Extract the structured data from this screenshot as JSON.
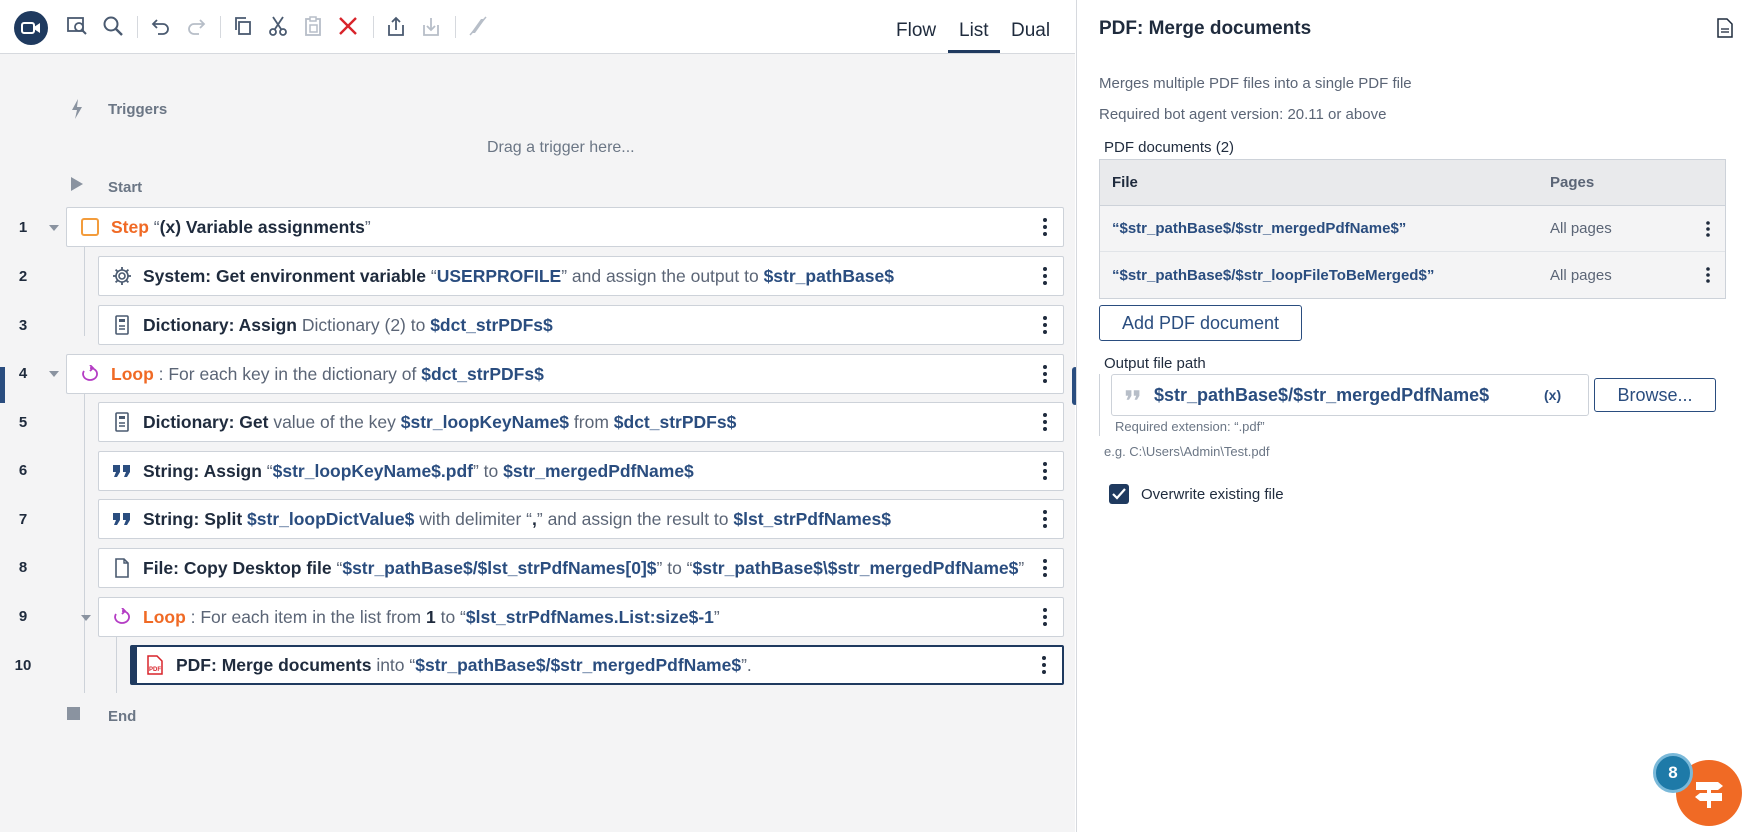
{
  "toolbar": {
    "views": [
      "Flow",
      "List",
      "Dual"
    ],
    "active_view": "List",
    "icons": [
      "record-icon",
      "search-file-icon",
      "search-icon",
      "undo-icon",
      "redo-icon",
      "copy-icon",
      "cut-icon",
      "paste-icon",
      "delete-icon",
      "export-icon",
      "import-icon",
      "disable-icon"
    ]
  },
  "editor": {
    "triggers_label": "Triggers",
    "drag_hint": "Drag a trigger here...",
    "start_label": "Start",
    "end_label": "End",
    "lines": [
      {
        "no": "1",
        "kind": "step",
        "parts": [
          [
            "orange",
            "Step"
          ],
          [
            "text",
            " “"
          ],
          [
            "bold",
            "(x) Variable assignments"
          ],
          [
            "text",
            "”"
          ]
        ]
      },
      {
        "no": "2",
        "kind": "system",
        "parts": [
          [
            "bold",
            "System: Get environment variable"
          ],
          [
            "text",
            " “"
          ],
          [
            "var",
            "USERPROFILE"
          ],
          [
            "text",
            "” and assign the output to "
          ],
          [
            "var",
            "$str_pathBase$"
          ]
        ]
      },
      {
        "no": "3",
        "kind": "dict",
        "parts": [
          [
            "bold",
            "Dictionary: Assign"
          ],
          [
            "text",
            " Dictionary (2) to "
          ],
          [
            "var",
            "$dct_strPDFs$"
          ]
        ]
      },
      {
        "no": "4",
        "kind": "loop",
        "parts": [
          [
            "orange",
            "Loop"
          ],
          [
            "text",
            " : For each key in the dictionary of "
          ],
          [
            "var",
            "$dct_strPDFs$"
          ]
        ]
      },
      {
        "no": "5",
        "kind": "dict",
        "parts": [
          [
            "bold",
            "Dictionary: Get"
          ],
          [
            "text",
            " value of the key "
          ],
          [
            "var",
            "$str_loopKeyName$"
          ],
          [
            "text",
            " from "
          ],
          [
            "var",
            "$dct_strPDFs$"
          ]
        ]
      },
      {
        "no": "6",
        "kind": "string",
        "parts": [
          [
            "bold",
            "String: Assign"
          ],
          [
            "text",
            " “"
          ],
          [
            "var",
            "$str_loopKeyName$.pdf"
          ],
          [
            "text",
            "” to "
          ],
          [
            "var",
            "$str_mergedPdfName$"
          ]
        ]
      },
      {
        "no": "7",
        "kind": "string",
        "parts": [
          [
            "bold",
            "String: Split"
          ],
          [
            "text",
            " "
          ],
          [
            "var",
            "$str_loopDictValue$"
          ],
          [
            "text",
            " with delimiter “"
          ],
          [
            "bold",
            ","
          ],
          [
            "text",
            "” and assign the result to "
          ],
          [
            "var",
            "$lst_strPdfNames$"
          ]
        ]
      },
      {
        "no": "8",
        "kind": "file",
        "parts": [
          [
            "bold",
            "File: Copy Desktop file"
          ],
          [
            "text",
            " “"
          ],
          [
            "var",
            "$str_pathBase$/$lst_strPdfNames[0]$"
          ],
          [
            "text",
            "” to “"
          ],
          [
            "var",
            "$str_pathBase$\\$str_mergedPdfName$"
          ],
          [
            "text",
            "”"
          ]
        ]
      },
      {
        "no": "9",
        "kind": "loop",
        "parts": [
          [
            "orange",
            "Loop"
          ],
          [
            "text",
            " : For each item in the list from "
          ],
          [
            "bold",
            "1"
          ],
          [
            "text",
            " to “"
          ],
          [
            "var",
            "$lst_strPdfNames.List:size$-1"
          ],
          [
            "text",
            "”"
          ]
        ]
      },
      {
        "no": "10",
        "kind": "pdf",
        "parts": [
          [
            "bold",
            "PDF: Merge documents"
          ],
          [
            "text",
            " into “"
          ],
          [
            "var",
            "$str_pathBase$/$str_mergedPdfName$"
          ],
          [
            "text",
            "”."
          ]
        ]
      }
    ]
  },
  "panel": {
    "title": "PDF: Merge documents",
    "description": "Merges multiple PDF files into a single PDF file",
    "required_version": "Required bot agent version: 20.11 or above",
    "pdf_documents_label": "PDF documents (2)",
    "table": {
      "headers": [
        "File",
        "Pages"
      ],
      "rows": [
        {
          "file": "“$str_pathBase$/$str_mergedPdfName$”",
          "pages": "All pages"
        },
        {
          "file": "“$str_pathBase$/$str_loopFileToBeMerged$”",
          "pages": "All pages"
        }
      ]
    },
    "add_button": "Add PDF document",
    "output_label": "Output file path",
    "output_value": "$str_pathBase$/$str_mergedPdfName$",
    "var_button": "(x)",
    "browse_button": "Browse...",
    "required_extension": "Required extension: “.pdf”",
    "example": "e.g. C:\\Users\\Admin\\Test.pdf",
    "overwrite_label": "Overwrite existing file",
    "overwrite_checked": true
  },
  "help": {
    "badge": "8"
  }
}
